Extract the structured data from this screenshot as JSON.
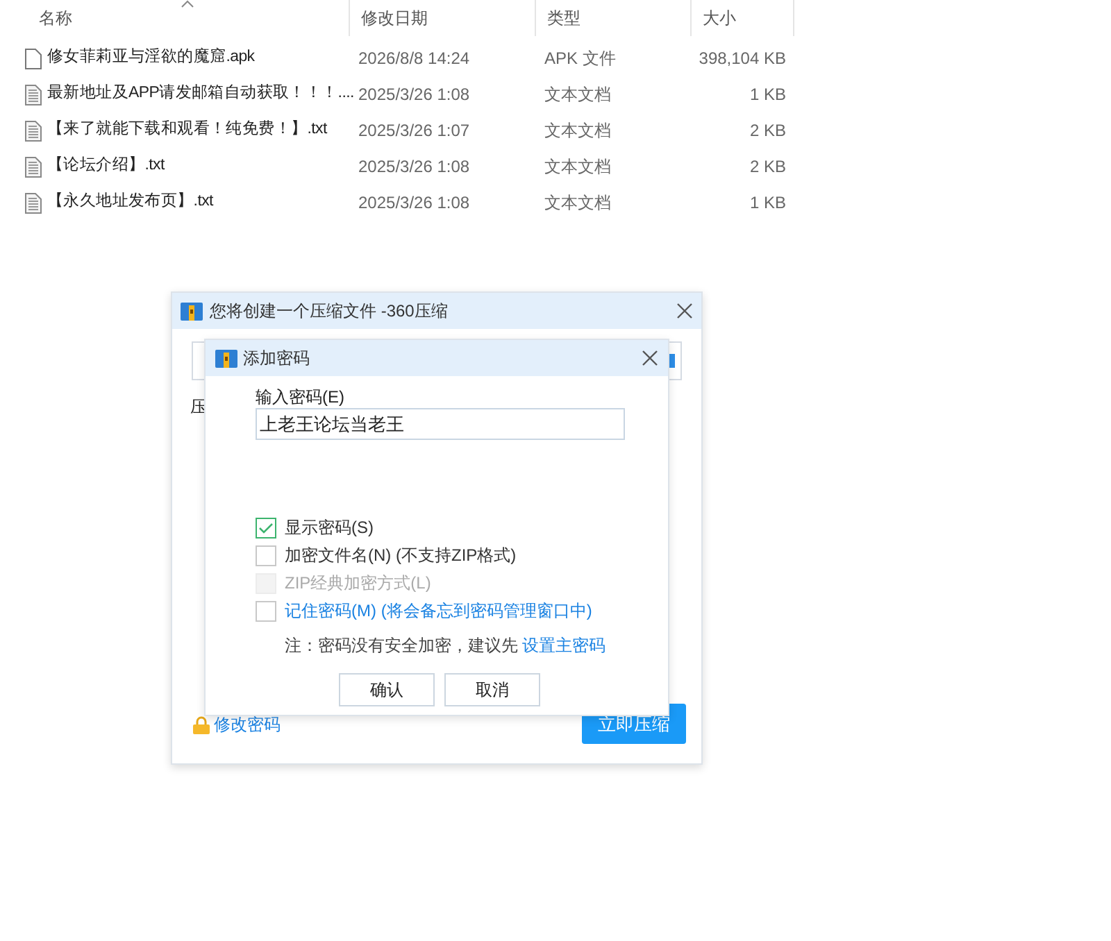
{
  "file_list": {
    "columns": [
      {
        "label": "名称",
        "sorted": true
      },
      {
        "label": "修改日期",
        "sorted": false
      },
      {
        "label": "类型",
        "sorted": false
      },
      {
        "label": "大小",
        "sorted": false
      }
    ],
    "rows": [
      {
        "kind": "file",
        "name": "修女菲莉亚与淫欲的魔窟.apk",
        "date": "2026/8/8 14:24",
        "type": "APK 文件",
        "size": "398,104 KB"
      },
      {
        "kind": "text",
        "name": "最新地址及APP请发邮箱自动获取！！！....",
        "date": "2025/3/26 1:08",
        "type": "文本文档",
        "size": "1 KB"
      },
      {
        "kind": "text",
        "name": "【来了就能下载和观看！纯免费！】.txt",
        "date": "2025/3/26 1:07",
        "type": "文本文档",
        "size": "2 KB"
      },
      {
        "kind": "text",
        "name": "【论坛介绍】.txt",
        "date": "2025/3/26 1:08",
        "type": "文本文档",
        "size": "2 KB"
      },
      {
        "kind": "text",
        "name": "【永久地址发布页】.txt",
        "date": "2025/3/26 1:08",
        "type": "文本文档",
        "size": "1 KB"
      }
    ]
  },
  "compress_dialog": {
    "title": "您将创建一个压缩文件 -360压缩",
    "side_label": "压",
    "change_password_link": "修改密码",
    "compress_button": "立即压缩"
  },
  "password_dialog": {
    "title": "添加密码",
    "password_label": "输入密码(E)",
    "password_value": "上老王论坛当老王",
    "options": [
      {
        "kind": "plain",
        "label": "显示密码(S)",
        "checked": true,
        "disabled": false
      },
      {
        "kind": "plain",
        "label": "加密文件名(N) (不支持ZIP格式)",
        "checked": false,
        "disabled": false
      },
      {
        "kind": "plain",
        "label": "ZIP经典加密方式(L)",
        "checked": false,
        "disabled": true
      },
      {
        "kind": "link",
        "label": "记住密码(M) (将会备忘到密码管理窗口中)",
        "checked": false,
        "disabled": false
      }
    ],
    "note": "注：密码没有安全加密，建议先",
    "note_link": "设置主密码",
    "buttons": [
      "确认",
      "取消"
    ]
  }
}
